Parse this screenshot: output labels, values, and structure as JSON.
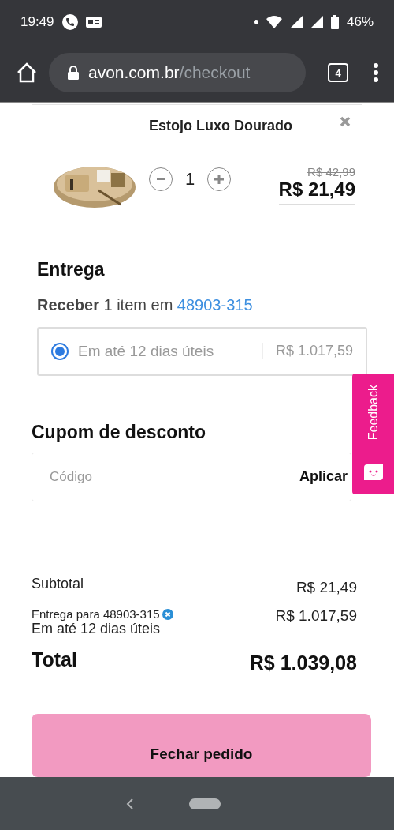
{
  "status_bar": {
    "time": "19:49",
    "battery": "46%"
  },
  "browser": {
    "url_host": "avon.com.br",
    "url_path": "/checkout",
    "tab_count": "4"
  },
  "cart_item": {
    "name": "Estojo Luxo Dourado",
    "quantity": "1",
    "old_price": "R$ 42,99",
    "price": "R$ 21,49"
  },
  "delivery": {
    "title": "Entrega",
    "summary": "**Receber** 1 item em",
    "zip": "48903-315",
    "options": [
      {
        "label": "Em até 12 dias úteis",
        "price": "R$ 1.017,59",
        "selected": true
      }
    ]
  },
  "coupon": {
    "title": "Cupom de desconto",
    "placeholder": "Código",
    "apply": "Aplicar"
  },
  "summary": {
    "subtotal_label": "Subtotal",
    "subtotal": "R$ 21,49",
    "shipping_label": "Entrega para 48903-315",
    "shipping_time": "Em até 12 dias úteis",
    "shipping": "R$ 1.017,59",
    "total_label": "Total",
    "total": "R$ 1.039,08"
  },
  "checkout_button": "Fechar pedido",
  "feedback_tab": "Feedback"
}
